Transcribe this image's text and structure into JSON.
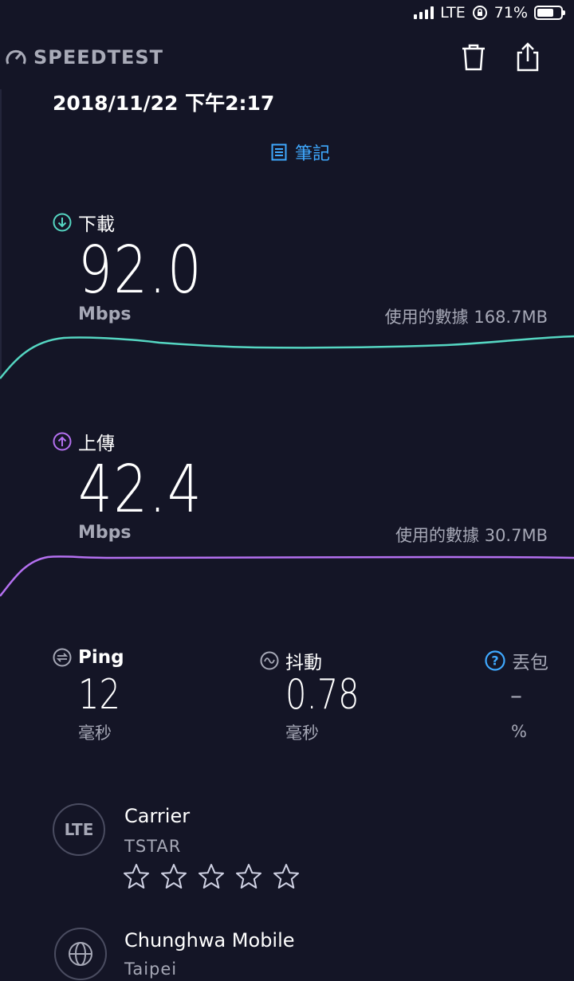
{
  "status_bar": {
    "network": "LTE",
    "battery": "71%",
    "battery_level": 0.71
  },
  "header": {
    "logo_text": "SPEEDTEST"
  },
  "result": {
    "datetime": "2018/11/22 下午2:17",
    "notes_label": "筆記"
  },
  "download": {
    "label": "下載",
    "value": "92.0",
    "unit": "Mbps",
    "data_used": "使用的數據 168.7MB"
  },
  "upload": {
    "label": "上傳",
    "value": "42.4",
    "unit": "Mbps",
    "data_used": "使用的數據 30.7MB"
  },
  "ping": {
    "label": "Ping",
    "value": "12",
    "unit": "毫秒"
  },
  "jitter": {
    "label": "抖動",
    "value": "0.78",
    "unit": "毫秒"
  },
  "packet_loss": {
    "label": "丟包",
    "value": "–",
    "unit": "%"
  },
  "carrier": {
    "badge": "LTE",
    "title": "Carrier",
    "name": "TSTAR",
    "rating": 0,
    "rating_max": 5
  },
  "server": {
    "title": "Chunghwa Mobile",
    "location": "Taipei"
  },
  "colors": {
    "background": "#141526",
    "download_accent": "#55d6c2",
    "upload_accent": "#b470f0",
    "link_accent": "#3fa9ff",
    "muted_text": "#a6a8b6"
  }
}
